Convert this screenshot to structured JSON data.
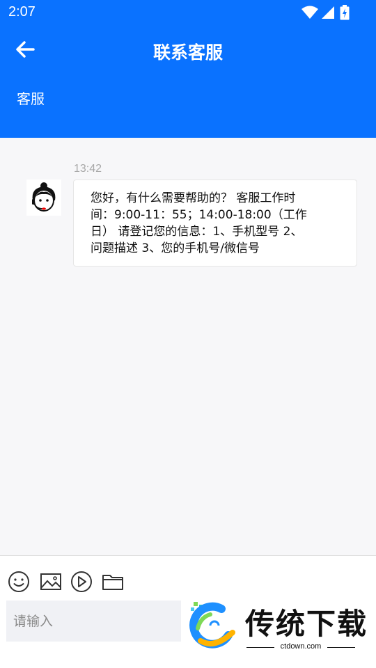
{
  "status_bar": {
    "time": "2:07",
    "icons": [
      "wifi-icon",
      "signal-icon",
      "battery-charging-icon"
    ]
  },
  "header": {
    "title": "联系客服",
    "subtitle": "客服",
    "back_icon": "arrow-left-icon",
    "color": "#0a72ff"
  },
  "chat": {
    "messages": [
      {
        "time": "13:42",
        "avatar_icon": "customer-service-avatar-icon",
        "lines": [
          "您好，有什么需要帮助的？ 客服工作时",
          "间：9:00-11：55；14:00-18:00（工作",
          "日） 请登记您的信息：1、手机型号 2、",
          "问题描述 3、您的手机号/微信号"
        ]
      }
    ]
  },
  "toolbar": {
    "tools": [
      "emoji-icon",
      "image-icon",
      "video-icon",
      "folder-icon"
    ]
  },
  "input": {
    "placeholder": "请输入",
    "value": ""
  },
  "watermark": {
    "text": "传统下载",
    "url": "ctdown.com"
  }
}
